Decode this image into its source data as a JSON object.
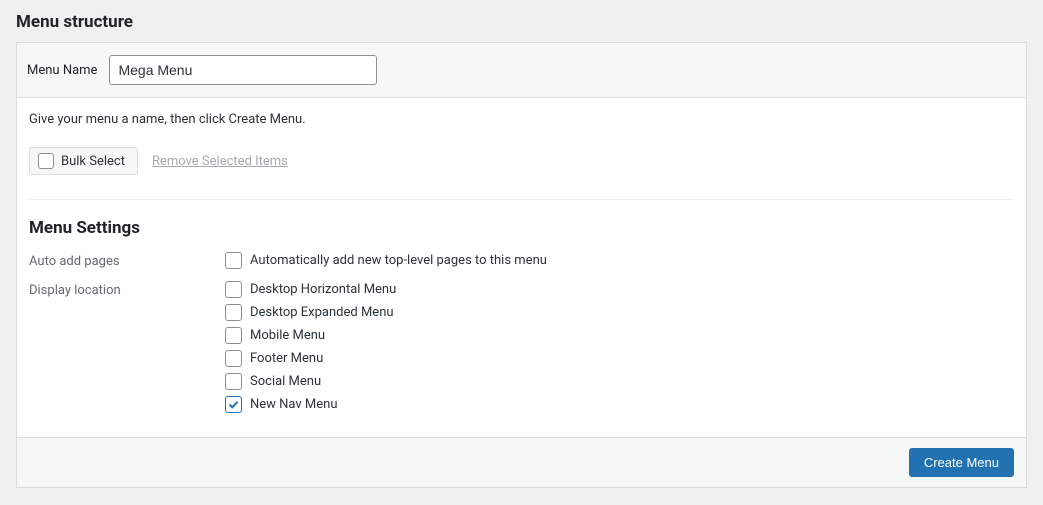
{
  "heading": "Menu structure",
  "menu_name_label": "Menu Name",
  "menu_name_value": "Mega Menu",
  "instruction": "Give your menu a name, then click Create Menu.",
  "bulk_select_label": "Bulk Select",
  "remove_selected_label": "Remove Selected Items",
  "settings_heading": "Menu Settings",
  "auto_add": {
    "label": "Auto add pages",
    "option": "Automatically add new top-level pages to this menu",
    "checked": false
  },
  "display_location": {
    "label": "Display location",
    "options": [
      {
        "label": "Desktop Horizontal Menu",
        "checked": false
      },
      {
        "label": "Desktop Expanded Menu",
        "checked": false
      },
      {
        "label": "Mobile Menu",
        "checked": false
      },
      {
        "label": "Footer Menu",
        "checked": false
      },
      {
        "label": "Social Menu",
        "checked": false
      },
      {
        "label": "New Nav Menu",
        "checked": true
      }
    ]
  },
  "create_button": "Create Menu"
}
